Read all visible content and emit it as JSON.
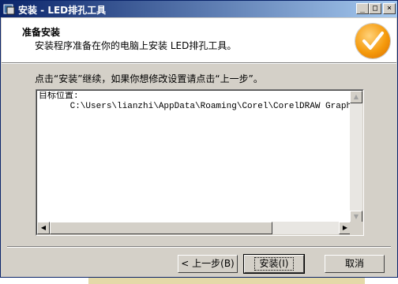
{
  "window": {
    "title": "安装 - LED排孔工具"
  },
  "caption_buttons": {
    "minimize": "_",
    "maximize": "□",
    "close": "×"
  },
  "header": {
    "title": "准备安装",
    "description": "安装程序准备在你的电脑上安装 LED排孔工具。",
    "logo_icon": "checkmark-icon"
  },
  "instruction": "点击“安装”继续，如果你想修改设置请点击“上一步”。",
  "memo": {
    "label": "目标位置:",
    "path": "      C:\\Users\\lianzhi\\AppData\\Roaming\\Corel\\CorelDRAW Graphics Su"
  },
  "scroll": {
    "up": "▲",
    "down": "▼",
    "left": "◀",
    "right": "▶"
  },
  "buttons": {
    "back": "< 上一步(B)",
    "install": "安装(I)",
    "cancel": "取消"
  },
  "colors": {
    "titlebar_start": "#0a246a",
    "titlebar_end": "#a6caf0",
    "face": "#d4d0c8",
    "logo": "#f59a0c"
  }
}
